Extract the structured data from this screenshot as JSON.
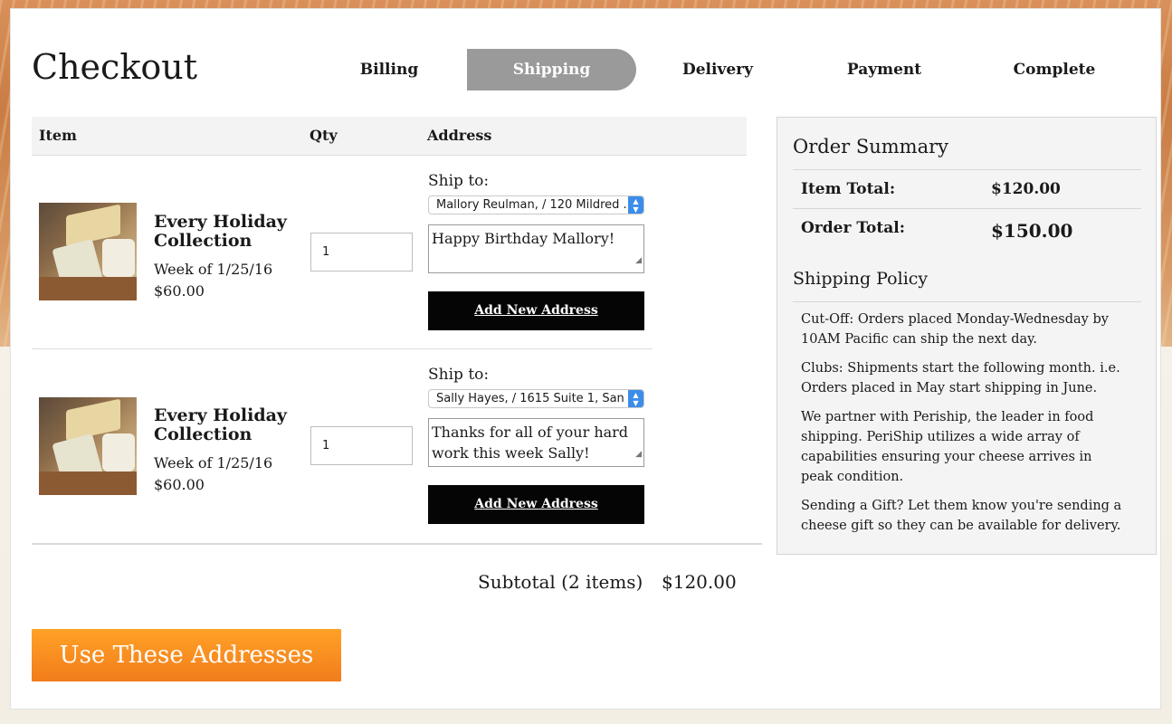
{
  "page": {
    "title": "Checkout"
  },
  "steps": [
    {
      "label": "Billing",
      "active": false
    },
    {
      "label": "Shipping",
      "active": true
    },
    {
      "label": "Delivery",
      "active": false
    },
    {
      "label": "Payment",
      "active": false
    },
    {
      "label": "Complete",
      "active": false
    }
  ],
  "cart": {
    "headers": {
      "item": "Item",
      "qty": "Qty",
      "address": "Address"
    },
    "items": [
      {
        "name": "Every Holiday Collection",
        "week": "Week of 1/25/16",
        "price": "$60.00",
        "qty": "1",
        "ship_to_label": "Ship to:",
        "address_selected": "Mallory Reulman, / 120 Mildred ...",
        "gift_message": "Happy Birthday Mallory!",
        "add_address_label": "Add New Address"
      },
      {
        "name": "Every Holiday Collection",
        "week": "Week of 1/25/16",
        "price": "$60.00",
        "qty": "1",
        "ship_to_label": "Ship to:",
        "address_selected": "Sally Hayes, / 1615 Suite 1, San ...",
        "gift_message": "Thanks for all of your hard work this week Sally!",
        "add_address_label": "Add New Address"
      }
    ],
    "subtotal_label": "Subtotal (2 items)",
    "subtotal_value": "$120.00",
    "submit_label": "Use These Addresses"
  },
  "summary": {
    "title": "Order Summary",
    "item_total_label": "Item Total:",
    "item_total_value": "$120.00",
    "order_total_label": "Order Total:",
    "order_total_value": "$150.00",
    "policy_title": "Shipping Policy",
    "policy": [
      "Cut-Off: Orders placed Monday-Wednesday by 10AM Pacific can ship the next day.",
      "Clubs: Shipments start the following month. i.e. Orders placed in May start shipping in June.",
      "We partner with Periship, the leader in food shipping. PeriShip utilizes a wide array of capabilities ensuring your cheese arrives in peak condition.",
      "Sending a Gift? Let them know you're sending a cheese gift so they can be available for delivery."
    ]
  },
  "colors": {
    "accent": "#f58a20",
    "step_active": "#9a9a9a",
    "button_dark": "#050505"
  },
  "icons": {
    "select_arrows": "updown-chevron-icon",
    "resize_grip": "resize-grip-icon"
  }
}
